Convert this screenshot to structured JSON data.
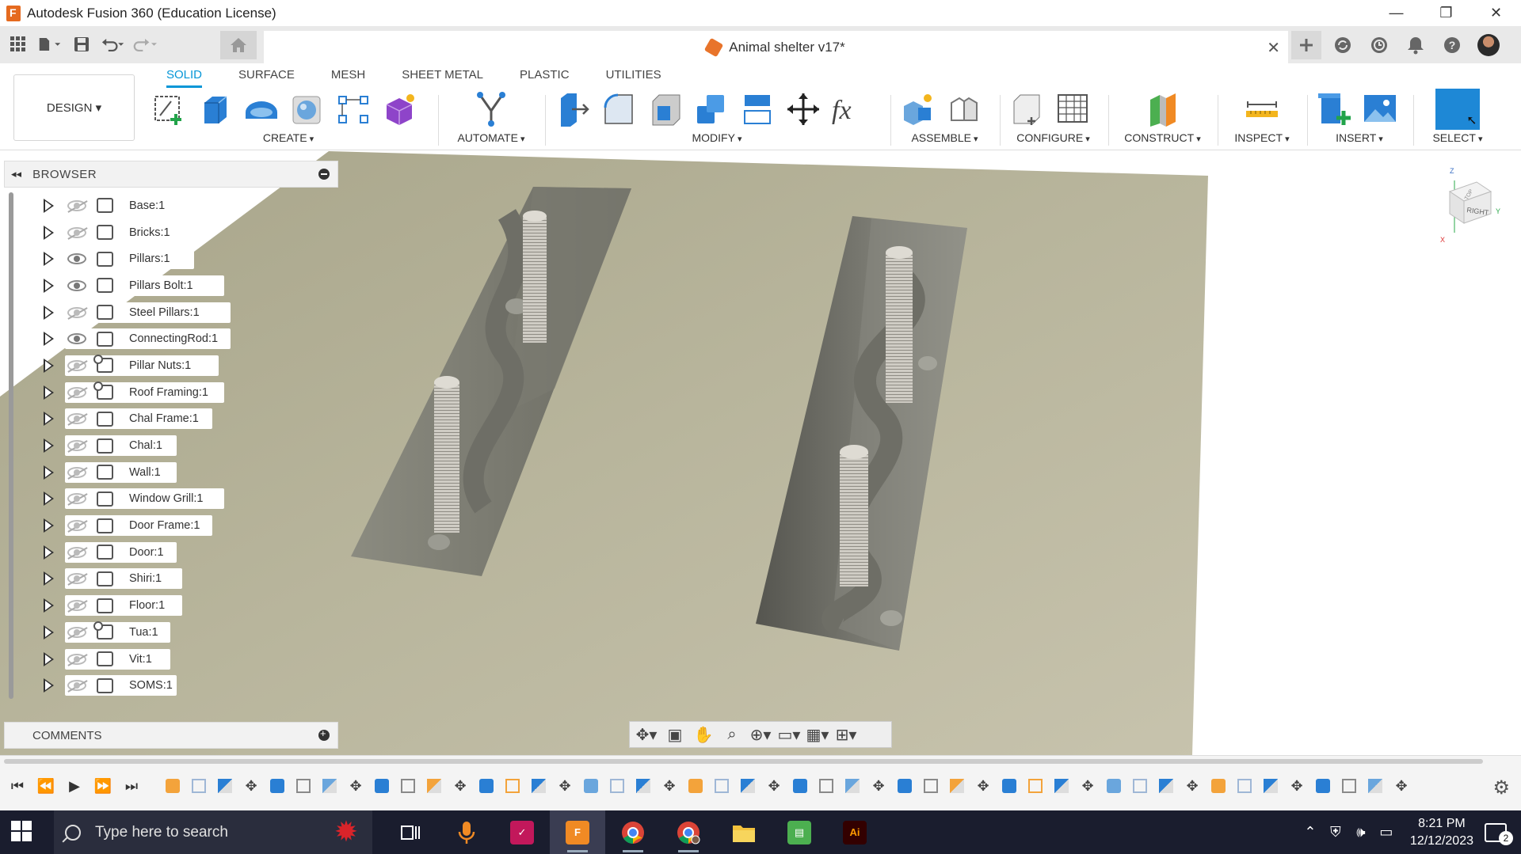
{
  "window": {
    "title": "Autodesk Fusion 360 (Education License)",
    "minimize": "—",
    "restore": "❐",
    "close": "✕"
  },
  "document": {
    "tab_title": "Animal shelter v17*",
    "close": "✕"
  },
  "workspace": {
    "label": "DESIGN ▾"
  },
  "ribbon_tabs": [
    "SOLID",
    "SURFACE",
    "MESH",
    "SHEET METAL",
    "PLASTIC",
    "UTILITIES"
  ],
  "groups": {
    "create": "CREATE",
    "automate": "AUTOMATE",
    "modify": "MODIFY",
    "assemble": "ASSEMBLE",
    "configure": "CONFIGURE",
    "construct": "CONSTRUCT",
    "inspect": "INSPECT",
    "insert": "INSERT",
    "select": "SELECT"
  },
  "browser": {
    "title": "BROWSER",
    "items": [
      {
        "label": "Base:1",
        "visible": false,
        "linked": false
      },
      {
        "label": "Bricks:1",
        "visible": false,
        "linked": false
      },
      {
        "label": "Pillars:1",
        "visible": true,
        "linked": false
      },
      {
        "label": "Pillars Bolt:1",
        "visible": true,
        "linked": false
      },
      {
        "label": "Steel Pillars:1",
        "visible": false,
        "linked": false
      },
      {
        "label": "ConnectingRod:1",
        "visible": true,
        "linked": false
      },
      {
        "label": "Pillar Nuts:1",
        "visible": false,
        "linked": true
      },
      {
        "label": "Roof Framing:1",
        "visible": false,
        "linked": true
      },
      {
        "label": "Chal Frame:1",
        "visible": false,
        "linked": false
      },
      {
        "label": "Chal:1",
        "visible": false,
        "linked": false
      },
      {
        "label": "Wall:1",
        "visible": false,
        "linked": false
      },
      {
        "label": "Window Grill:1",
        "visible": false,
        "linked": false
      },
      {
        "label": "Door Frame:1",
        "visible": false,
        "linked": false
      },
      {
        "label": "Door:1",
        "visible": false,
        "linked": false
      },
      {
        "label": "Shiri:1",
        "visible": false,
        "linked": false
      },
      {
        "label": "Floor:1",
        "visible": false,
        "linked": false
      },
      {
        "label": "Tua:1",
        "visible": false,
        "linked": true
      },
      {
        "label": "Vit:1",
        "visible": false,
        "linked": false
      },
      {
        "label": "SOMS:1",
        "visible": false,
        "linked": false
      }
    ]
  },
  "comments": {
    "title": "COMMENTS"
  },
  "viewcube": {
    "face": "RIGHT",
    "top": "TOP",
    "axis_z": "Z",
    "axis_y": "Y",
    "axis_x": "X"
  },
  "taskbar": {
    "search_placeholder": "Type here to search",
    "time": "8:21 PM",
    "date": "12/12/2023",
    "notifications": "2"
  },
  "colors": {
    "accent": "#0696d7",
    "taskbar": "#1a1d2e",
    "fusion_orange": "#e56a1f"
  }
}
